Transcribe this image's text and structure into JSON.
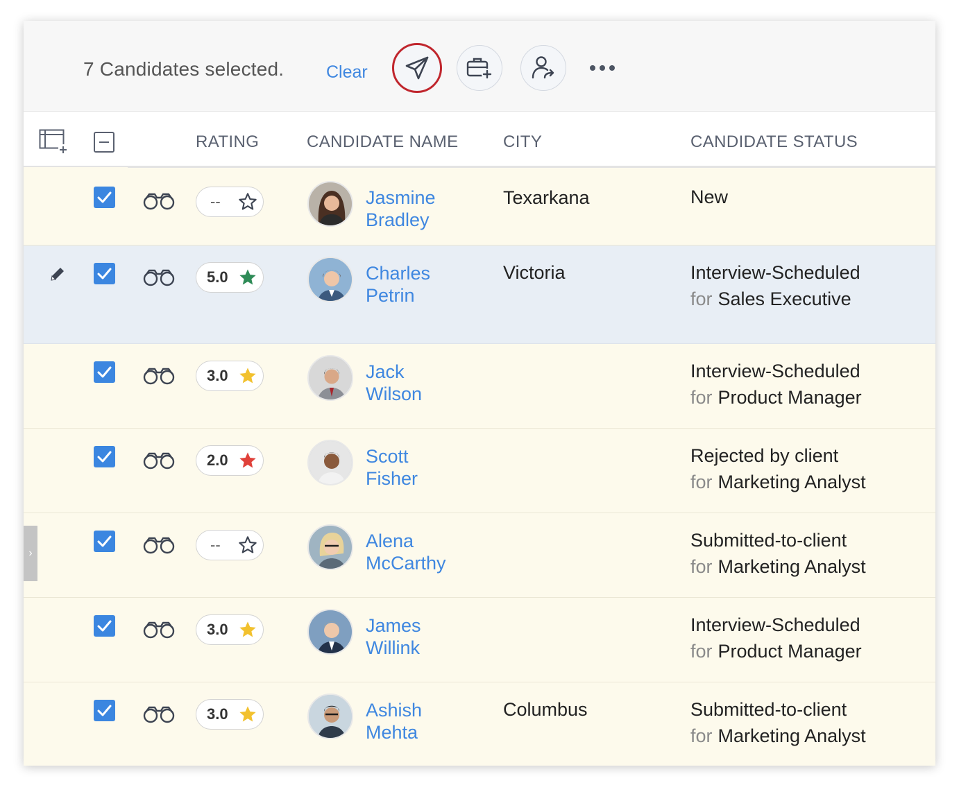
{
  "toolbar": {
    "selected_count": "7",
    "selected_text": "Candidates selected.",
    "clear_label": "Clear",
    "buttons": [
      "send-icon",
      "briefcase-add-icon",
      "person-forward-icon",
      "more-icon"
    ]
  },
  "header": {
    "rating": "RATING",
    "candidate_name": "CANDIDATE NAME",
    "city": "CITY",
    "candidate_status": "CANDIDATE STATUS"
  },
  "colors": {
    "accent": "#3f87e0",
    "highlight_row": "#e8eef5",
    "row_bg": "#fdfaec",
    "send_ring": "#c0262d",
    "star_green": "#2e8b57",
    "star_yellow": "#f2c12e",
    "star_red": "#e0413a"
  },
  "rows": [
    {
      "rating": "--",
      "star": "outline",
      "first": "Jasmine",
      "last": "Bradley",
      "city": "Texarkana",
      "status": "New",
      "job": "",
      "for": ""
    },
    {
      "rating": "5.0",
      "star": "green",
      "first": "Charles",
      "last": "Petrin",
      "city": "Victoria",
      "status": "Interview-Scheduled",
      "job": "Sales Executive",
      "for": "for"
    },
    {
      "rating": "3.0",
      "star": "yellow",
      "first": "Jack",
      "last": "Wilson",
      "city": "",
      "status": "Interview-Scheduled",
      "job": "Product Manager",
      "for": "for"
    },
    {
      "rating": "2.0",
      "star": "red",
      "first": "Scott",
      "last": "Fisher",
      "city": "",
      "status": "Rejected by client",
      "job": "Marketing Analyst",
      "for": "for"
    },
    {
      "rating": "--",
      "star": "outline",
      "first": "Alena",
      "last": "McCarthy",
      "city": "",
      "status": "Submitted-to-client",
      "job": "Marketing Analyst",
      "for": "for"
    },
    {
      "rating": "3.0",
      "star": "yellow",
      "first": "James",
      "last": "Willink",
      "city": "",
      "status": "Interview-Scheduled",
      "job": "Product Manager",
      "for": "for"
    },
    {
      "rating": "3.0",
      "star": "yellow",
      "first": "Ashish",
      "last": "Mehta",
      "city": "Columbus",
      "status": "Submitted-to-client",
      "job": "Marketing Analyst",
      "for": "for"
    }
  ]
}
